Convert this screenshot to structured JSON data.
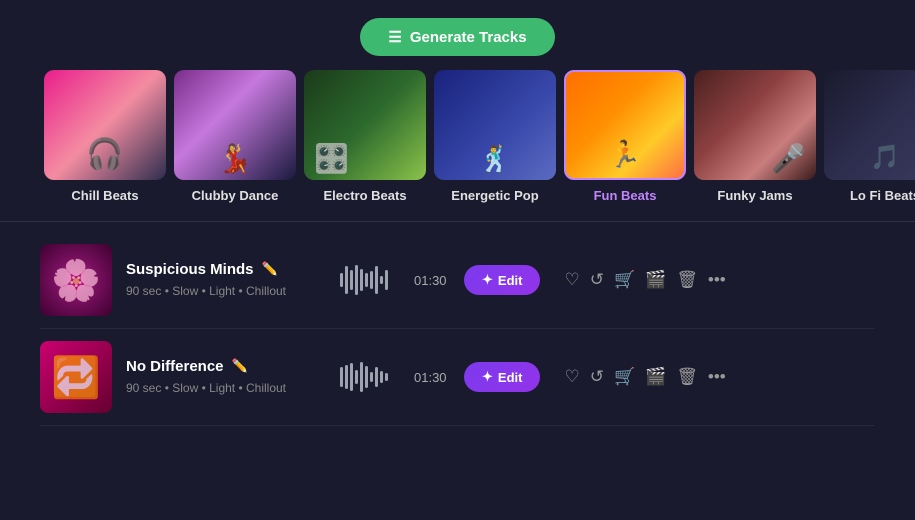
{
  "header": {
    "generate_label": "Generate Tracks"
  },
  "genres": [
    {
      "id": "chill-beats",
      "label": "Chill Beats",
      "active": false,
      "img_class": "img-chill"
    },
    {
      "id": "clubby-dance",
      "label": "Clubby Dance",
      "active": false,
      "img_class": "img-clubby"
    },
    {
      "id": "electro-beats",
      "label": "Electro Beats",
      "active": false,
      "img_class": "img-electro"
    },
    {
      "id": "energetic-pop",
      "label": "Energetic Pop",
      "active": false,
      "img_class": "img-energetic"
    },
    {
      "id": "fun-beats",
      "label": "Fun Beats",
      "active": true,
      "img_class": "img-funbeats"
    },
    {
      "id": "funky-jams",
      "label": "Funky Jams",
      "active": false,
      "img_class": "img-funky"
    },
    {
      "id": "lofi-beats",
      "label": "Lo Fi Beats",
      "active": false,
      "img_class": "img-lofi"
    }
  ],
  "tracks": [
    {
      "id": "suspicious-minds",
      "title": "Suspicious Minds",
      "meta": "90 sec • Slow • Light • Chillout",
      "duration": "01:30",
      "thumb_class": "thumb-suspicious"
    },
    {
      "id": "no-difference",
      "title": "No Difference",
      "meta": "90 sec • Slow • Light • Chillout",
      "duration": "01:30",
      "thumb_class": "thumb-nodiff"
    }
  ],
  "actions": {
    "edit_label": "Edit",
    "like_icon": "♡",
    "regenerate_icon": "↺",
    "cart_icon": "🛒",
    "video_icon": "🎬",
    "delete_icon": "🗑",
    "more_icon": "···"
  }
}
